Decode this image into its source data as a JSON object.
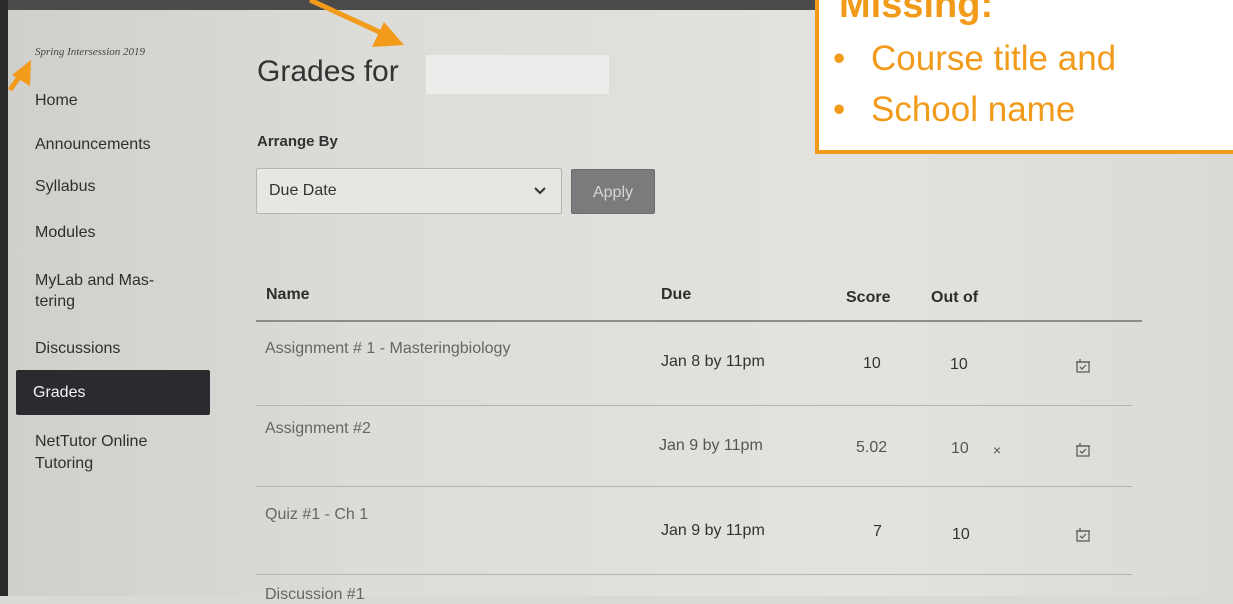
{
  "sidebar": {
    "term": "Spring Intersession 2019",
    "items": [
      {
        "label": "Home"
      },
      {
        "label": "Announcements"
      },
      {
        "label": "Syllabus"
      },
      {
        "label": "Modules"
      },
      {
        "label": "MyLab and Mas-\ntering"
      },
      {
        "label": "Discussions"
      },
      {
        "label": "Grades"
      },
      {
        "label": "NetTutor Online\nTutoring"
      }
    ],
    "active": "Grades"
  },
  "main": {
    "title": "Grades for",
    "arrange_label": "Arrange By",
    "arrange_value": "Due Date",
    "apply_label": "Apply"
  },
  "table": {
    "headers": [
      "Name",
      "Due",
      "Score",
      "Out of"
    ],
    "rows": [
      {
        "name": "Assignment # 1 - Masteringbiology",
        "due": "Jan 8 by 11pm",
        "score": "10",
        "out_of": "10"
      },
      {
        "name": "Assignment #2",
        "due": "Jan 9 by 11pm",
        "score": "5.02",
        "out_of": "10",
        "mark": "×"
      },
      {
        "name": "Quiz #1 - Ch 1",
        "due": "Jan 9 by 11pm",
        "score": "7",
        "out_of": "10"
      },
      {
        "name": "Discussion #1"
      }
    ]
  },
  "callout": {
    "title": "Missing:",
    "items": [
      "Course title and",
      "School name"
    ],
    "color": "#f29a1a"
  },
  "icons": {
    "rubric": "rubric-icon",
    "chevron": "chevron-down-icon"
  }
}
